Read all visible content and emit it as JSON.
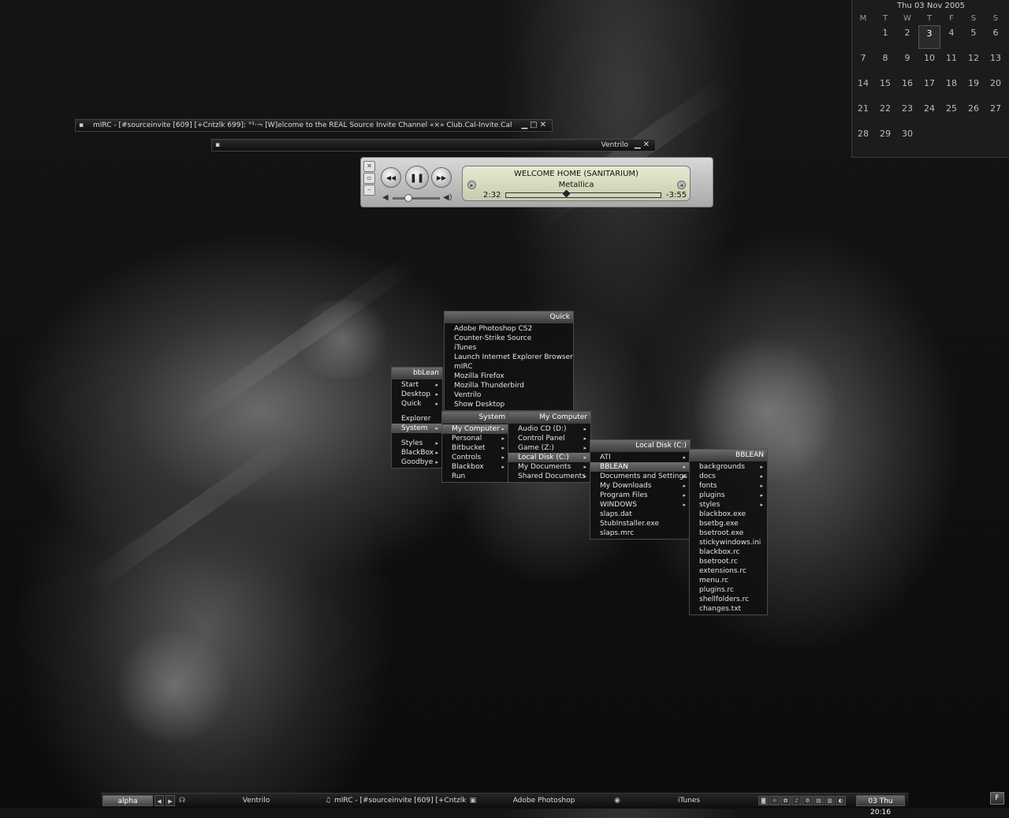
{
  "calendar": {
    "title": "Thu 03 Nov  2005",
    "weekdays": [
      "M",
      "T",
      "W",
      "T",
      "F",
      "S",
      "S"
    ],
    "weeks": [
      [
        "",
        "1",
        "2",
        "3",
        "4",
        "5",
        "6"
      ],
      [
        "7",
        "8",
        "9",
        "10",
        "11",
        "12",
        "13"
      ],
      [
        "14",
        "15",
        "16",
        "17",
        "18",
        "19",
        "20"
      ],
      [
        "21",
        "22",
        "23",
        "24",
        "25",
        "26",
        "27"
      ],
      [
        "28",
        "29",
        "30",
        "",
        "",
        "",
        ""
      ]
    ],
    "today": "3"
  },
  "mirc_window": {
    "icon": "▪",
    "title": "mIRC - [#sourceinvite [609] [+Cntzlk 699]: °¹·¬ [W]elcome to the REAL Source Invite Channel «×» Club.Cal-Invite.Cal «×» ..."
  },
  "ventrilo_window": {
    "icon": "▪",
    "title": "Ventrilo"
  },
  "window_buttons": {
    "minimize": "▁",
    "maximize": "□",
    "close": "✕"
  },
  "itunes": {
    "song": "WELCOME HOME (SANITARIUM)",
    "artist": "Metallica",
    "elapsed": "2:32",
    "remaining": "-3:55",
    "progress": 0.39,
    "volume": 0.3,
    "buttons": {
      "prev": "◀◀",
      "pause": "❚❚",
      "next": "▶▶"
    }
  },
  "menus": {
    "bblean": {
      "title": "bbLean",
      "items": [
        {
          "label": "Start",
          "sub": true
        },
        {
          "label": "Desktop",
          "sub": true
        },
        {
          "label": "Quick",
          "sub": true
        },
        {
          "label": "Explorer",
          "sub": false
        },
        {
          "label": "System",
          "sub": true,
          "selected": true
        },
        {
          "label": "Styles",
          "sub": true
        },
        {
          "label": "BlackBox",
          "sub": true
        },
        {
          "label": "Goodbye",
          "sub": true
        }
      ]
    },
    "quick": {
      "title": "Quick",
      "items": [
        "Adobe Photoshop CS2",
        "Counter-Strike Source",
        "iTunes",
        "Launch Internet Explorer Browser",
        "mIRC",
        "Mozilla Firefox",
        "Mozilla Thunderbird",
        "Ventrilo",
        "Show Desktop"
      ]
    },
    "system": {
      "title": "System",
      "items": [
        {
          "label": "My Computer",
          "sub": true,
          "selected": true
        },
        {
          "label": "Personal",
          "sub": true
        },
        {
          "label": "Bitbucket",
          "sub": true
        },
        {
          "label": "Controls",
          "sub": true
        },
        {
          "label": "Blackbox",
          "sub": true
        },
        {
          "label": "Run",
          "sub": false
        }
      ]
    },
    "my_computer": {
      "title": "My Computer",
      "items": [
        {
          "label": "Audio CD (D:)",
          "sub": true
        },
        {
          "label": "Control Panel",
          "sub": true
        },
        {
          "label": "Game (Z:)",
          "sub": true
        },
        {
          "label": "Local Disk (C:)",
          "sub": true,
          "selected": true
        },
        {
          "label": "My Documents",
          "sub": true
        },
        {
          "label": "Shared Documents",
          "sub": true
        }
      ]
    },
    "local_disk": {
      "title": "Local Disk (C:)",
      "items": [
        {
          "label": "ATI",
          "sub": true
        },
        {
          "label": "BBLEAN",
          "sub": true,
          "selected": true
        },
        {
          "label": "Documents and Settings",
          "sub": true
        },
        {
          "label": "My Downloads",
          "sub": true
        },
        {
          "label": "Program Files",
          "sub": true
        },
        {
          "label": "WINDOWS",
          "sub": true
        },
        {
          "label": "slaps.dat",
          "sub": false
        },
        {
          "label": "StubInstaller.exe",
          "sub": false
        },
        {
          "label": "slaps.mrc",
          "sub": false
        }
      ]
    },
    "bblean_folder": {
      "title": "BBLEAN",
      "items": [
        {
          "label": "backgrounds",
          "sub": true
        },
        {
          "label": "docs",
          "sub": true
        },
        {
          "label": "fonts",
          "sub": true
        },
        {
          "label": "plugins",
          "sub": true
        },
        {
          "label": "styles",
          "sub": true
        },
        {
          "label": "blackbox.exe",
          "sub": false
        },
        {
          "label": "bsetbg.exe",
          "sub": false
        },
        {
          "label": "bsetroot.exe",
          "sub": false
        },
        {
          "label": "stickywindows.ini",
          "sub": false
        },
        {
          "label": "blackbox.rc",
          "sub": false
        },
        {
          "label": "bsetroot.rc",
          "sub": false
        },
        {
          "label": "extensions.rc",
          "sub": false
        },
        {
          "label": "menu.rc",
          "sub": false
        },
        {
          "label": "plugins.rc",
          "sub": false
        },
        {
          "label": "shellfolders.rc",
          "sub": false
        },
        {
          "label": "changes.txt",
          "sub": false
        }
      ]
    }
  },
  "taskbar": {
    "workspace": "alpha",
    "left_arrow": "◀",
    "right_arrow": "▶",
    "tasks": [
      {
        "icon": "☊",
        "label": "Ventrilo"
      },
      {
        "icon": "♫",
        "label": "mIRC - [#sourceinvite [609] [+Cntzlk..."
      },
      {
        "icon": "▣",
        "label": "Adobe Photoshop"
      },
      {
        "icon": "◉",
        "label": "iTunes"
      }
    ],
    "tray": [
      "◙",
      "☼",
      "✿",
      "♪",
      "⚙",
      "▤",
      "▥",
      "◐"
    ],
    "clock": "03 Thu 20:16",
    "corner": "F"
  }
}
